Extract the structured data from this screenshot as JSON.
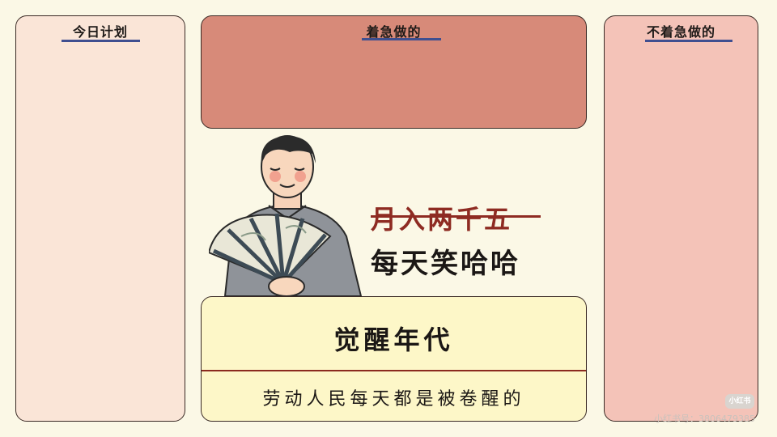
{
  "panels": {
    "left_title": "今日计划",
    "top_title": "着急做的",
    "right_title": "不着急做的"
  },
  "slogan": {
    "struck": "月入两千五",
    "main": "每天笑哈哈"
  },
  "card": {
    "headline": "觉醒年代",
    "subline": "劳动人民每天都是被卷醒的"
  },
  "watermark": {
    "badge": "小红书",
    "text": "小红书号：3806479385"
  },
  "colors": {
    "background": "#fbf8e6",
    "left_panel": "#fae5d7",
    "top_panel": "#d78a79",
    "right_panel": "#f4c3b8",
    "card": "#fdf7c8",
    "accent_red": "#8e2b22",
    "underline_blue": "#3f4f90"
  }
}
